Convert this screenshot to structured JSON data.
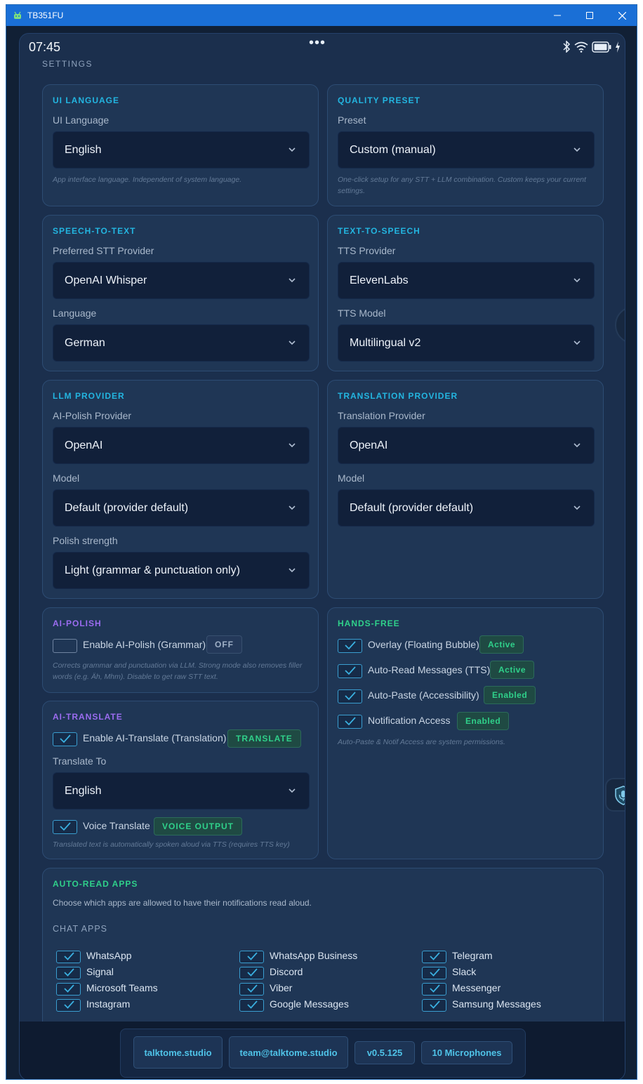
{
  "window": {
    "title": "TB351FU"
  },
  "status_bar": {
    "time": "07:45",
    "dots": "•••"
  },
  "header": {
    "title": "SETTINGS"
  },
  "ui_language": {
    "section": "UI LANGUAGE",
    "label": "UI Language",
    "value": "English",
    "help": "App interface language. Independent of system language."
  },
  "quality_preset": {
    "section": "QUALITY PRESET",
    "label": "Preset",
    "value": "Custom (manual)",
    "help": "One-click setup for any STT + LLM combination. Custom keeps your current settings."
  },
  "stt": {
    "section": "SPEECH-TO-TEXT",
    "provider_label": "Preferred STT Provider",
    "provider_value": "OpenAI Whisper",
    "language_label": "Language",
    "language_value": "German"
  },
  "tts": {
    "section": "TEXT-TO-SPEECH",
    "provider_label": "TTS Provider",
    "provider_value": "ElevenLabs",
    "model_label": "TTS Model",
    "model_value": "Multilingual v2"
  },
  "llm": {
    "section": "LLM PROVIDER",
    "provider_label": "AI-Polish Provider",
    "provider_value": "OpenAI",
    "model_label": "Model",
    "model_value": "Default (provider default)",
    "strength_label": "Polish strength",
    "strength_value": "Light (grammar & punctuation only)"
  },
  "translation": {
    "section": "TRANSLATION PROVIDER",
    "provider_label": "Translation Provider",
    "provider_value": "OpenAI",
    "model_label": "Model",
    "model_value": "Default (provider default)"
  },
  "ai_polish": {
    "section": "AI-POLISH",
    "enable_label": "Enable AI-Polish (Grammar)",
    "enable_checked": false,
    "badge": "OFF",
    "help": "Corrects grammar and punctuation via LLM. Strong mode also removes filler words (e.g. Äh, Mhm). Disable to get raw STT text."
  },
  "ai_translate": {
    "section": "AI-TRANSLATE",
    "enable_label": "Enable AI-Translate (Translation)",
    "enable_checked": true,
    "badge": "TRANSLATE",
    "translate_to_label": "Translate To",
    "translate_to_value": "English",
    "voice_label": "Voice Translate",
    "voice_checked": true,
    "voice_badge": "VOICE OUTPUT",
    "help": "Translated text is automatically spoken aloud via TTS (requires TTS key)"
  },
  "hands_free": {
    "section": "HANDS-FREE",
    "items": [
      {
        "label": "Overlay (Floating Bubble)",
        "checked": true,
        "badge": "Active"
      },
      {
        "label": "Auto-Read Messages (TTS)",
        "checked": true,
        "badge": "Active"
      },
      {
        "label": "Auto-Paste (Accessibility)",
        "checked": true,
        "badge": "Enabled"
      },
      {
        "label": "Notification Access",
        "checked": true,
        "badge": "Enabled"
      }
    ],
    "help": "Auto-Paste & Notif Access are system permissions."
  },
  "auto_read_apps": {
    "section": "AUTO-READ APPS",
    "description": "Choose which apps are allowed to have their notifications read aloud.",
    "group_label": "CHAT APPS",
    "apps": [
      {
        "name": "WhatsApp",
        "checked": true
      },
      {
        "name": "WhatsApp Business",
        "checked": true
      },
      {
        "name": "Telegram",
        "checked": true
      },
      {
        "name": "Signal",
        "checked": true
      },
      {
        "name": "Discord",
        "checked": true
      },
      {
        "name": "Slack",
        "checked": true
      },
      {
        "name": "Microsoft Teams",
        "checked": true
      },
      {
        "name": "Viber",
        "checked": true
      },
      {
        "name": "Messenger",
        "checked": true
      },
      {
        "name": "Instagram",
        "checked": true
      },
      {
        "name": "Google Messages",
        "checked": true
      },
      {
        "name": "Samsung Messages",
        "checked": true
      }
    ]
  },
  "footer": {
    "website": "talktome.studio",
    "email": "team@talktome.studio",
    "version": "v0.5.125",
    "microphones": "10 Microphones"
  },
  "colors": {
    "accent_cyan": "#23b5e0",
    "accent_green": "#2fd08a",
    "accent_purple": "#9b6cf0",
    "background": "#1b2f4d",
    "card": "#1f3655",
    "select": "#11203a",
    "titlebar": "#1a6fd6"
  },
  "icons": [
    "app-icon",
    "minimize-icon",
    "maximize-icon",
    "close-icon",
    "bluetooth-icon",
    "wifi-icon",
    "battery-icon",
    "charging-icon",
    "chevron-down-icon",
    "check-icon",
    "pencil-icon",
    "shield-mic-icon"
  ]
}
